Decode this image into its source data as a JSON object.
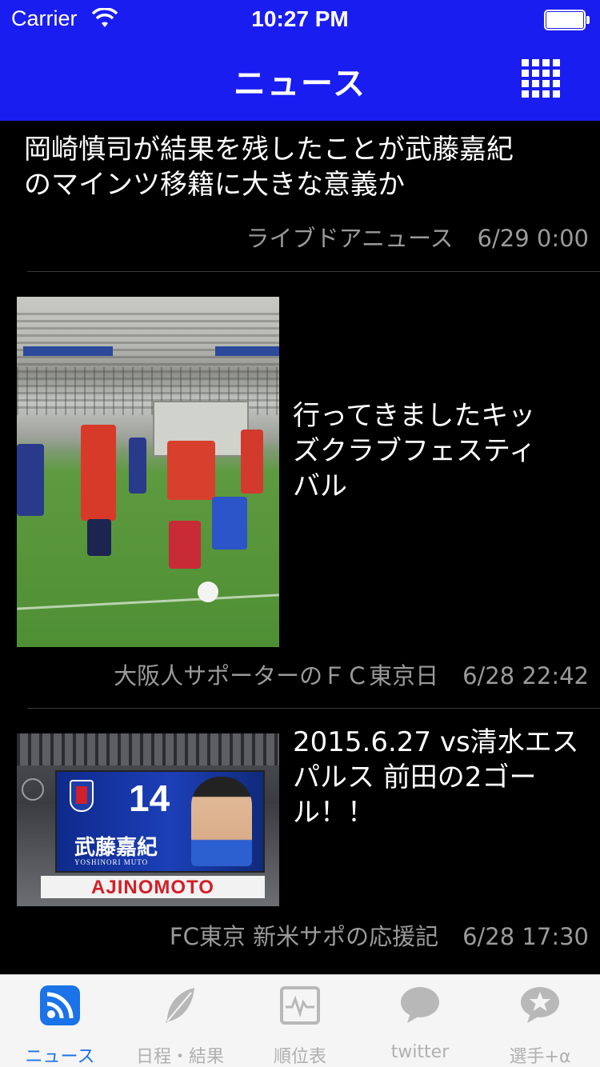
{
  "status_bar": {
    "carrier": "Carrier",
    "time": "10:27 PM"
  },
  "nav": {
    "title": "ニュース",
    "menu_icon": "grid-menu-icon"
  },
  "news": [
    {
      "title_lines": [
        "岡崎慎司が結果を残したことが武藤嘉紀",
        "のマインツ移籍に大きな意義か"
      ],
      "source": "ライブドアニュース",
      "date": "6/29 0:00",
      "thumbnail": null
    },
    {
      "title_lines": [
        "行ってきましたキッ",
        "ズクラブフェスティ",
        "バル"
      ],
      "source": "大阪人サポーターのＦＣ東京日",
      "date": "6/28 22:42",
      "thumbnail": "photo-kids-club-festival"
    },
    {
      "title_lines": [
        "2015.6.27 vs清水エス",
        "パルス 前田の2ゴー",
        "ル！！"
      ],
      "source": "FC東京 新米サポの応援記",
      "date": "6/28 17:30",
      "thumbnail": "photo-scoreboard",
      "thumbnail_text": {
        "number": "14",
        "name": "武藤嘉紀",
        "name_roman": "YOSHINORI MUTO",
        "ad": "AJINOMOTO"
      }
    }
  ],
  "tabs": [
    {
      "label": "ニュース",
      "icon": "rss-icon",
      "active": true
    },
    {
      "label": "日程・結果",
      "icon": "feather-icon",
      "active": false
    },
    {
      "label": "順位表",
      "icon": "pulse-chart-icon",
      "active": false
    },
    {
      "label": "twitter",
      "icon": "speech-bubble-icon",
      "active": false
    },
    {
      "label": "選手+α",
      "icon": "star-bubble-icon",
      "active": false
    }
  ],
  "colors": {
    "nav_background": "#1a1df0",
    "tab_active": "#1a73e8",
    "tab_inactive": "#b0b0b0"
  }
}
